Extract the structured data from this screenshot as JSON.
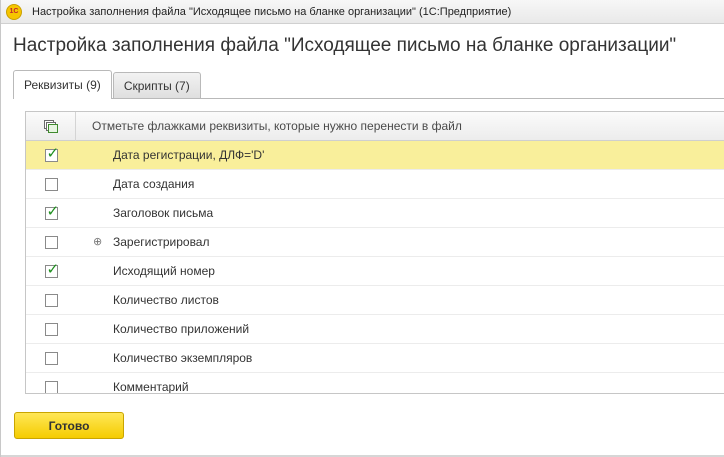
{
  "window": {
    "logo_text": "1С",
    "title": "Настройка заполнения файла \"Исходящее письмо на бланке организации\"  (1С:Предприятие)"
  },
  "form": {
    "heading": "Настройка заполнения файла \"Исходящее письмо на бланке организации\""
  },
  "tabs": [
    {
      "label": "Реквизиты (9)",
      "active": true
    },
    {
      "label": "Скрипты (7)",
      "active": false
    }
  ],
  "table": {
    "header_icon": "check-all-icon",
    "header_label": "Отметьте флажками реквизиты, которые нужно перенести в файл",
    "rows": [
      {
        "label": "Дата регистрации, ДЛФ='D'",
        "checked": true,
        "expandable": false,
        "selected": true
      },
      {
        "label": "Дата создания",
        "checked": false,
        "expandable": false,
        "selected": false
      },
      {
        "label": "Заголовок письма",
        "checked": true,
        "expandable": false,
        "selected": false
      },
      {
        "label": "Зарегистрировал",
        "checked": false,
        "expandable": true,
        "selected": false
      },
      {
        "label": "Исходящий номер",
        "checked": true,
        "expandable": false,
        "selected": false
      },
      {
        "label": "Количество листов",
        "checked": false,
        "expandable": false,
        "selected": false
      },
      {
        "label": "Количество приложений",
        "checked": false,
        "expandable": false,
        "selected": false
      },
      {
        "label": "Количество экземпляров",
        "checked": false,
        "expandable": false,
        "selected": false
      },
      {
        "label": "Комментарий",
        "checked": false,
        "expandable": false,
        "selected": false
      }
    ]
  },
  "footer": {
    "done_label": "Готово"
  },
  "colors": {
    "accent_yellow": "#f5cc00",
    "selected_row": "#f9ef9b",
    "checkmark_green": "#1e8f1e"
  }
}
